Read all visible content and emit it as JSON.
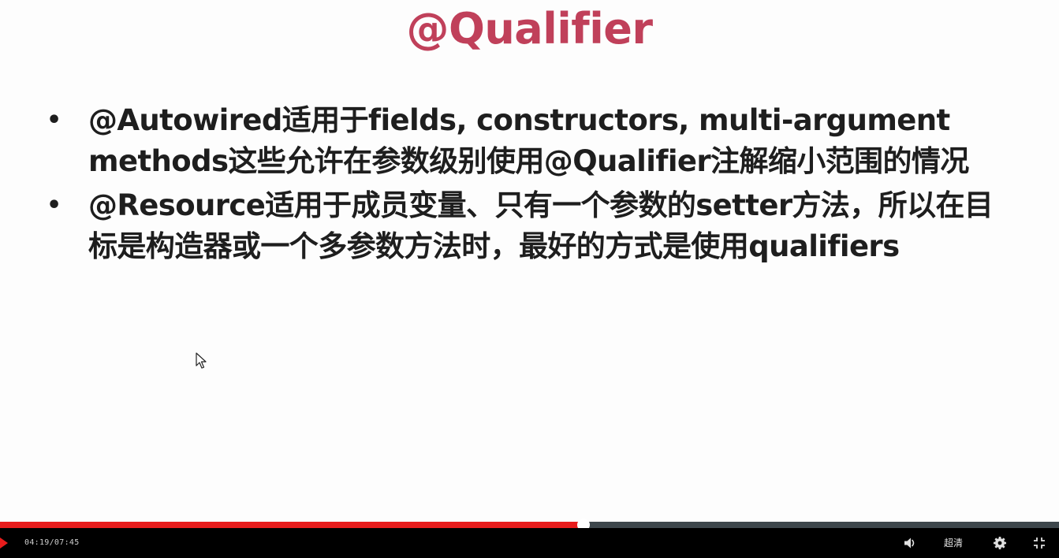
{
  "slide": {
    "title": "@Qualifier",
    "bullets": [
      "@Autowired适用于fields, constructors, multi-argument methods这些允许在参数级别使用@Qualifier注解缩小范围的情况",
      "@Resource适用于成员变量、只有一个参数的setter方法，所以在目标是构造器或一个多参数方法时，最好的方式是使用qualifiers"
    ],
    "title_color": "#c0405a",
    "text_color": "#1e1e1e"
  },
  "player": {
    "time": "04:19/07:45",
    "progress": 0.551,
    "quality_label": "超清",
    "icons": [
      "play-icon",
      "volume-icon",
      "settings-gear-icon",
      "exit-fullscreen-icon"
    ],
    "progress_color": "#e81c1c",
    "track_color": "#3e474c"
  }
}
